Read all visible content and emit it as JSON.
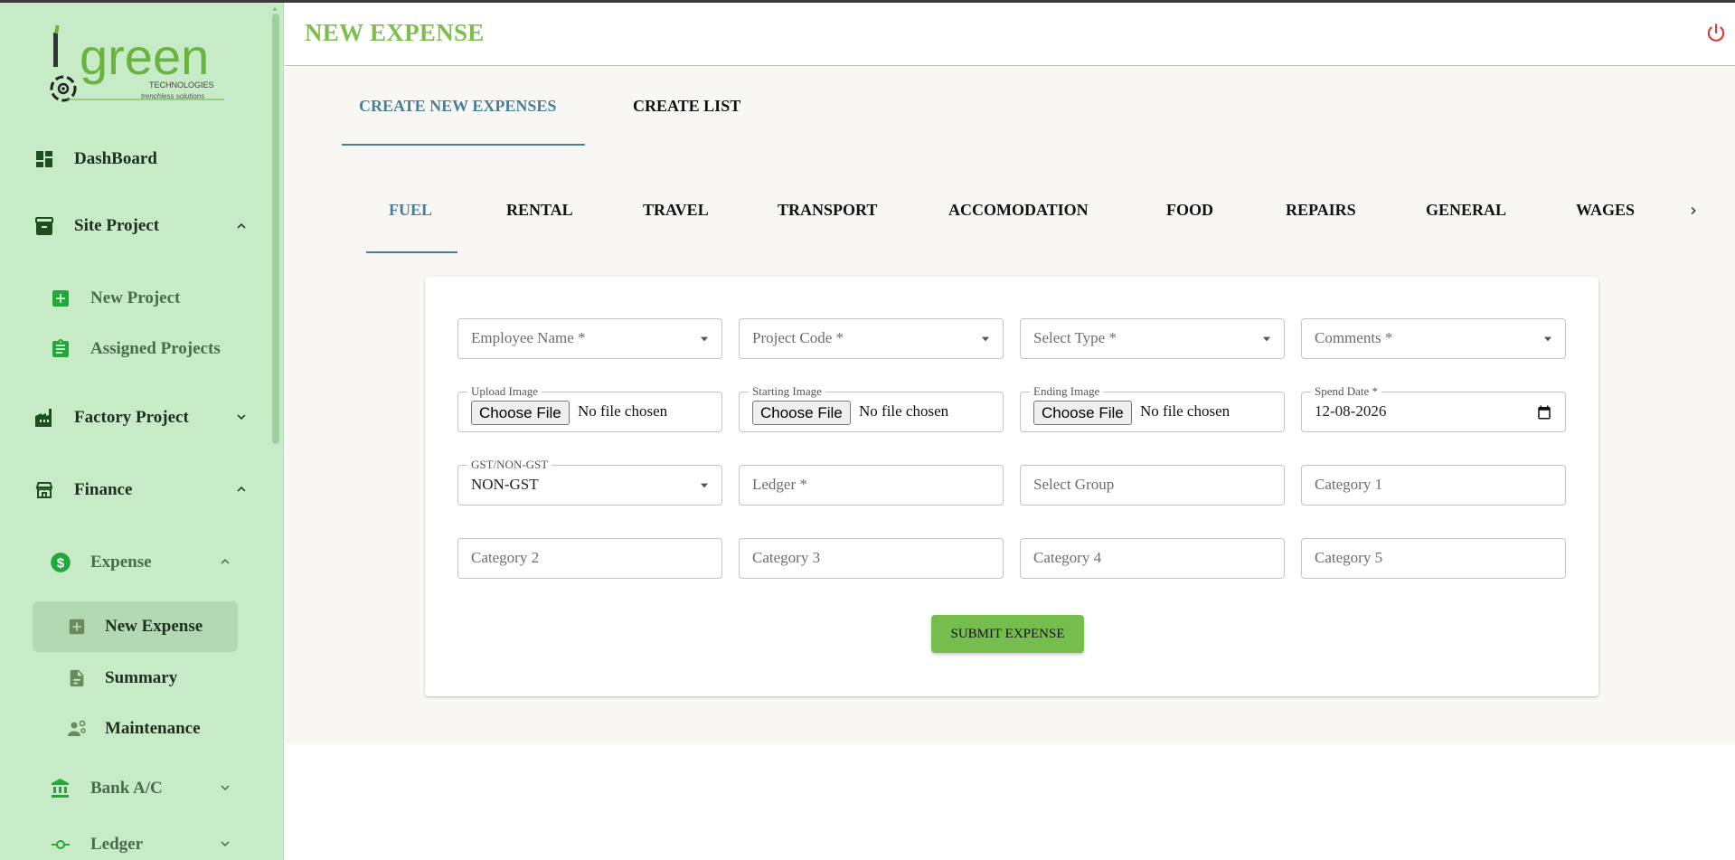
{
  "app": {
    "logo_text": "green",
    "logo_sub1": "TECHNOLOGIES",
    "logo_sub2": "trenchless solutions"
  },
  "sidebar": {
    "items": [
      {
        "label": "DashBoard",
        "icon": "dashboard-icon"
      },
      {
        "label": "Site Project",
        "icon": "archive-icon",
        "expanded": true
      },
      {
        "label": "New Project",
        "icon": "add-box-icon"
      },
      {
        "label": "Assigned Projects",
        "icon": "assignment-icon"
      },
      {
        "label": "Factory Project",
        "icon": "factory-icon",
        "expanded": false
      },
      {
        "label": "Finance",
        "icon": "store-icon",
        "expanded": true
      },
      {
        "label": "Expense",
        "icon": "dollar-circle-icon",
        "expanded": true
      },
      {
        "label": "New Expense",
        "icon": "add-box-icon",
        "active": true
      },
      {
        "label": "Summary",
        "icon": "document-icon"
      },
      {
        "label": "Maintenance",
        "icon": "engineering-icon"
      },
      {
        "label": "Bank A/C",
        "icon": "bank-icon",
        "expanded": false
      },
      {
        "label": "Ledger",
        "icon": "commit-icon",
        "expanded": false
      }
    ]
  },
  "header": {
    "title": "NEW EXPENSE",
    "power_icon": "power-icon"
  },
  "top_tabs": [
    {
      "label": "CREATE NEW EXPENSES",
      "active": true
    },
    {
      "label": "CREATE LIST",
      "active": false
    }
  ],
  "category_tabs": [
    {
      "label": "FUEL",
      "active": true
    },
    {
      "label": "RENTAL"
    },
    {
      "label": "TRAVEL"
    },
    {
      "label": "TRANSPORT"
    },
    {
      "label": "ACCOMODATION"
    },
    {
      "label": "FOOD"
    },
    {
      "label": "REPAIRS"
    },
    {
      "label": "GENERAL"
    },
    {
      "label": "WAGES"
    }
  ],
  "form": {
    "employee_name": {
      "placeholder": "Employee Name *"
    },
    "project_code": {
      "placeholder": "Project Code *"
    },
    "select_type": {
      "placeholder": "Select Type *"
    },
    "comments": {
      "placeholder": "Comments *"
    },
    "upload_image": {
      "label": "Upload Image",
      "button": "Choose File",
      "status": "No file chosen"
    },
    "starting_image": {
      "label": "Starting Image",
      "button": "Choose File",
      "status": "No file chosen"
    },
    "ending_image": {
      "label": "Ending Image",
      "button": "Choose File",
      "status": "No file chosen"
    },
    "spend_date": {
      "label": "Spend Date *",
      "value": "12-08-2026"
    },
    "gst": {
      "label": "GST/NON-GST",
      "value": "NON-GST"
    },
    "ledger": {
      "placeholder": "Ledger *"
    },
    "select_group": {
      "placeholder": "Select Group"
    },
    "category1": {
      "placeholder": "Category 1"
    },
    "category2": {
      "placeholder": "Category 2"
    },
    "category3": {
      "placeholder": "Category 3"
    },
    "category4": {
      "placeholder": "Category 4"
    },
    "category5": {
      "placeholder": "Category 5"
    },
    "submit_label": "SUBMIT EXPENSE"
  },
  "colors": {
    "sidebar_bg": "#c6ebc6",
    "accent_green": "#7cbf4a",
    "tab_blue": "#4a7e96",
    "submit_green": "#75bd4c",
    "power_red": "#e53935"
  }
}
